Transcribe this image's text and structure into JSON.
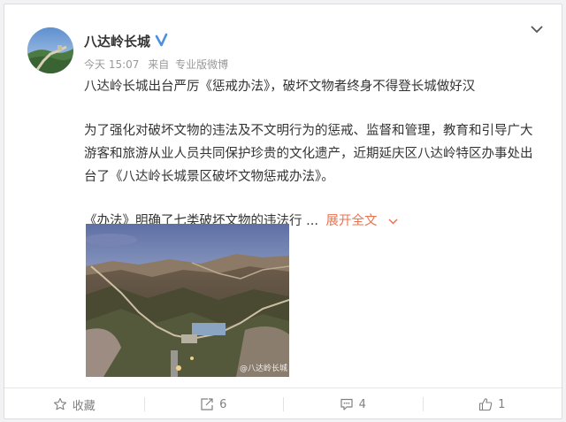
{
  "user": {
    "name": "八达岭长城",
    "time": "今天 15:07",
    "from_label": "来自",
    "source": "专业版微博"
  },
  "post": {
    "line1": "八达岭长城出台严厉《惩戒办法》，破坏文物者终身不得登长城做好汉",
    "para2_line1": "为了强化对破坏文物的违法及不文明行为的惩戒、监督和管理，教育和引导广大",
    "para2_line2": "游客和旅游从业人员共同保护珍贵的文化遗产，近期延庆区八达岭特区办事处出",
    "para2_line3": "台了《八达岭长城景区破坏文物惩戒办法》。",
    "para3": "《办法》明确了七类破坏文物的违法行 ...",
    "expand_label": "展开全文"
  },
  "image": {
    "watermark": "@八达岭长城"
  },
  "actions": {
    "favorite_label": "收藏",
    "repost_count": "6",
    "comment_count": "4",
    "like_count": "1"
  },
  "colors": {
    "link": "#eb7350",
    "verified": "#4a90e2",
    "muted": "#999999"
  },
  "icons": [
    "verified-icon",
    "chevron-down-icon",
    "star-icon",
    "repost-icon",
    "comment-icon",
    "like-icon"
  ]
}
